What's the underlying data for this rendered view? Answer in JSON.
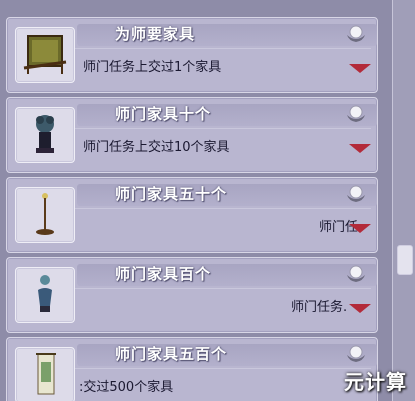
{
  "tasks": [
    {
      "title": "为师要家具",
      "desc": "师门任务上交过1个家具",
      "icon": "screen-furniture-icon"
    },
    {
      "title": "师门家具十个",
      "desc": "师门任务上交过10个家具",
      "icon": "plant-stand-icon"
    },
    {
      "title": "师门家具五十个",
      "desc": "师门任",
      "icon": "lamp-stand-icon"
    },
    {
      "title": "师门家具百个",
      "desc": "师门任务.",
      "icon": "vase-icon"
    },
    {
      "title": "师门家具五百个",
      "desc": ":交过500个家具",
      "icon": "scroll-painting-icon"
    }
  ],
  "watermark": "元计算",
  "colors": {
    "panel": "#b9b6d0",
    "accent_arrow": "#b32a3a",
    "background": "#8e8ca8"
  }
}
